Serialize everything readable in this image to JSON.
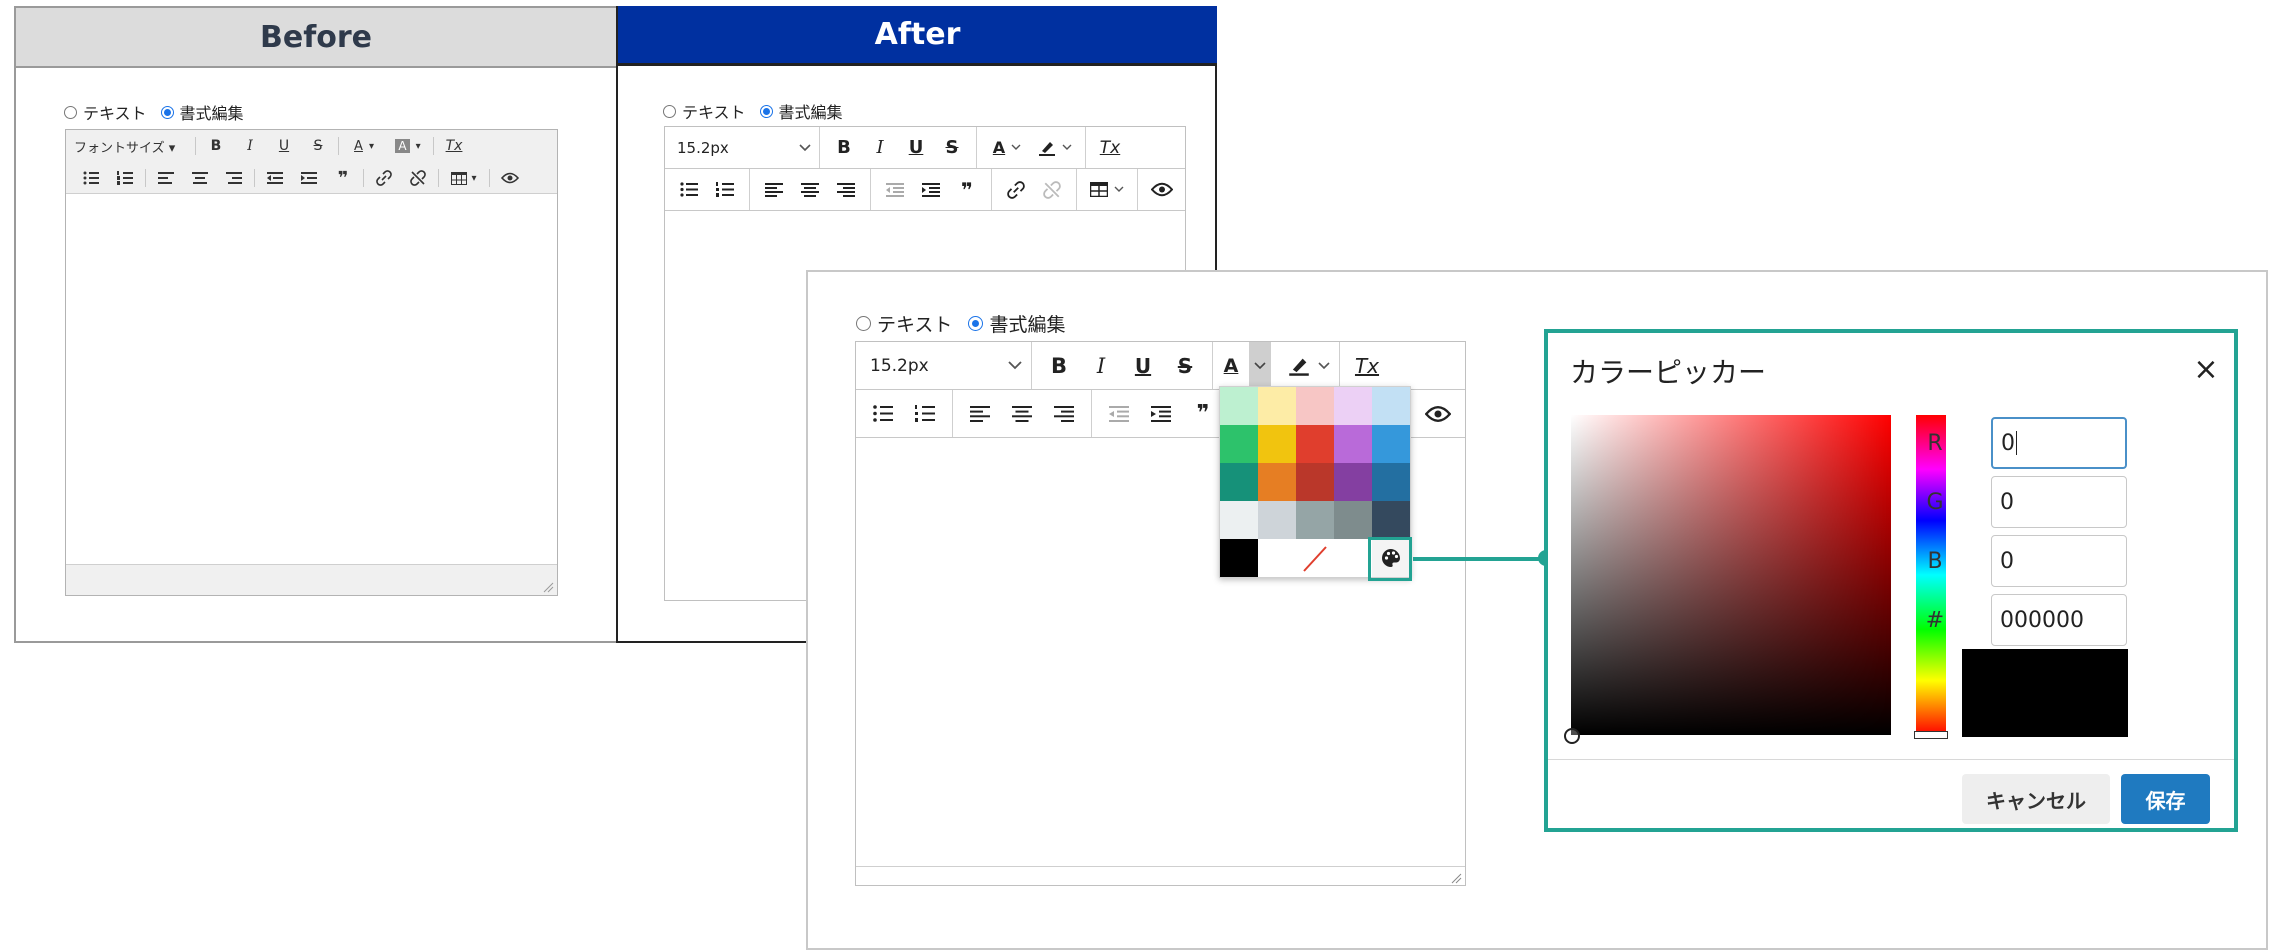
{
  "before": {
    "title": "Before",
    "radio_text": "テキスト",
    "radio_rich": "書式編集",
    "font_size_menu": "フォントサイズ ▾"
  },
  "after": {
    "title": "After",
    "radio_text": "テキスト",
    "radio_rich": "書式編集",
    "font_size_value": "15.2px"
  },
  "zoom": {
    "radio_text": "テキスト",
    "radio_rich": "書式編集",
    "font_size_value": "15.2px",
    "palette_colors": [
      [
        "#bdf0d0",
        "#fdeca6",
        "#f7c6c5",
        "#ecd0f5",
        "#c2e0f4"
      ],
      [
        "#2dc26b",
        "#f1c40f",
        "#e03e2d",
        "#b96ad9",
        "#3598db"
      ],
      [
        "#169179",
        "#e67e23",
        "#ba372a",
        "#843fa1",
        "#236fa1"
      ],
      [
        "#ecf0f1",
        "#ced4d9",
        "#95a5a6",
        "#7e8c8d",
        "#34495e"
      ]
    ],
    "palette_black": "#000000",
    "no_color_mark": "#e03e2d"
  },
  "picker": {
    "title": "カラーピッカー",
    "close_symbol": "×",
    "r_label": "R",
    "r_value": "0",
    "g_label": "G",
    "g_value": "0",
    "b_label": "B",
    "b_value": "0",
    "hex_label": "#",
    "hex_value": "000000",
    "cancel_label": "キャンセル",
    "save_label": "保存",
    "accent": "#23a393",
    "save_color": "#1f7ac0"
  },
  "icons": {
    "bold": "B",
    "italic": "I",
    "underline": "U",
    "strike": "S",
    "text_color": "A",
    "clear_format": "Tx",
    "blockquote": "❞"
  }
}
